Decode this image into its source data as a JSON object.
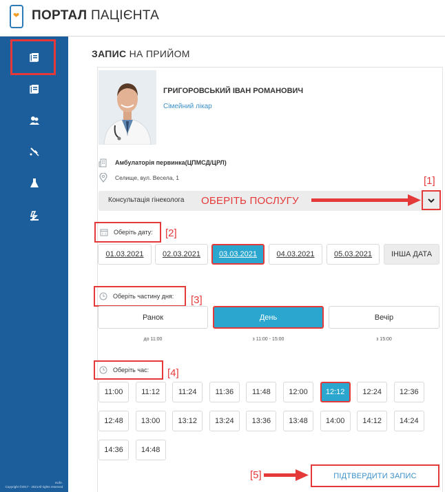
{
  "header": {
    "brand_bold": "ПОРТАЛ",
    "brand_rest": "ПАЦІЄНТА"
  },
  "sidebar": {
    "items": [
      {
        "icon": "document-icon"
      },
      {
        "icon": "document-icon"
      },
      {
        "icon": "users-icon"
      },
      {
        "icon": "stethoscope-icon"
      },
      {
        "icon": "flask-icon"
      },
      {
        "icon": "medicine-icon"
      }
    ],
    "copyright_brand": "eLife.",
    "copyright": "Copyright ©2017 - 2021All rights reserved"
  },
  "page": {
    "title_bold": "ЗАПИС",
    "title_rest": "НА ПРИЙОМ"
  },
  "doctor": {
    "name": "ГРИГОРОВСЬКИЙ ІВАН РОМАНОВИЧ",
    "role": "Сімейний лікар",
    "clinic": "Амбулаторія первинка(ЦПМСД/ЦРЛ)",
    "address": "Селище, вул. Весела, 1"
  },
  "service": {
    "selected": "Консультація гінеколога"
  },
  "annotations": {
    "n1": "[1]",
    "n2": "[2]",
    "n3": "[3]",
    "n4": "[4]",
    "n5": "[5]",
    "choose_service": "ОБЕРІТЬ ПОСЛУГУ"
  },
  "date": {
    "label": "Оберіть дату:",
    "options": [
      "01.03.2021",
      "02.03.2021",
      "03.03.2021",
      "04.03.2021",
      "05.03.2021"
    ],
    "selected": "03.03.2021",
    "other": "ІНША ДАТА"
  },
  "day_part": {
    "label": "Оберіть частину дня:",
    "options": [
      {
        "label": "Ранок",
        "range": "до 11:00"
      },
      {
        "label": "День",
        "range": "з 11:00 - 15:00"
      },
      {
        "label": "Вечір",
        "range": "з 15:00"
      }
    ],
    "selected": "День"
  },
  "time": {
    "label": "Оберіть час:",
    "slots": [
      "11:00",
      "11:12",
      "11:24",
      "11:36",
      "11:48",
      "12:00",
      "12:12",
      "12:24",
      "12:36",
      "12:48",
      "13:00",
      "13:12",
      "13:24",
      "13:36",
      "13:48",
      "14:00",
      "14:12",
      "14:24",
      "14:36",
      "14:48"
    ],
    "selected": "12:12"
  },
  "confirm_label": "ПІДТВЕРДИТИ ЗАПИС",
  "colors": {
    "sidebar": "#1b5e9b",
    "accent": "#2aa6cf",
    "annotation": "#e53939",
    "logo_heart": "#f0a028"
  }
}
